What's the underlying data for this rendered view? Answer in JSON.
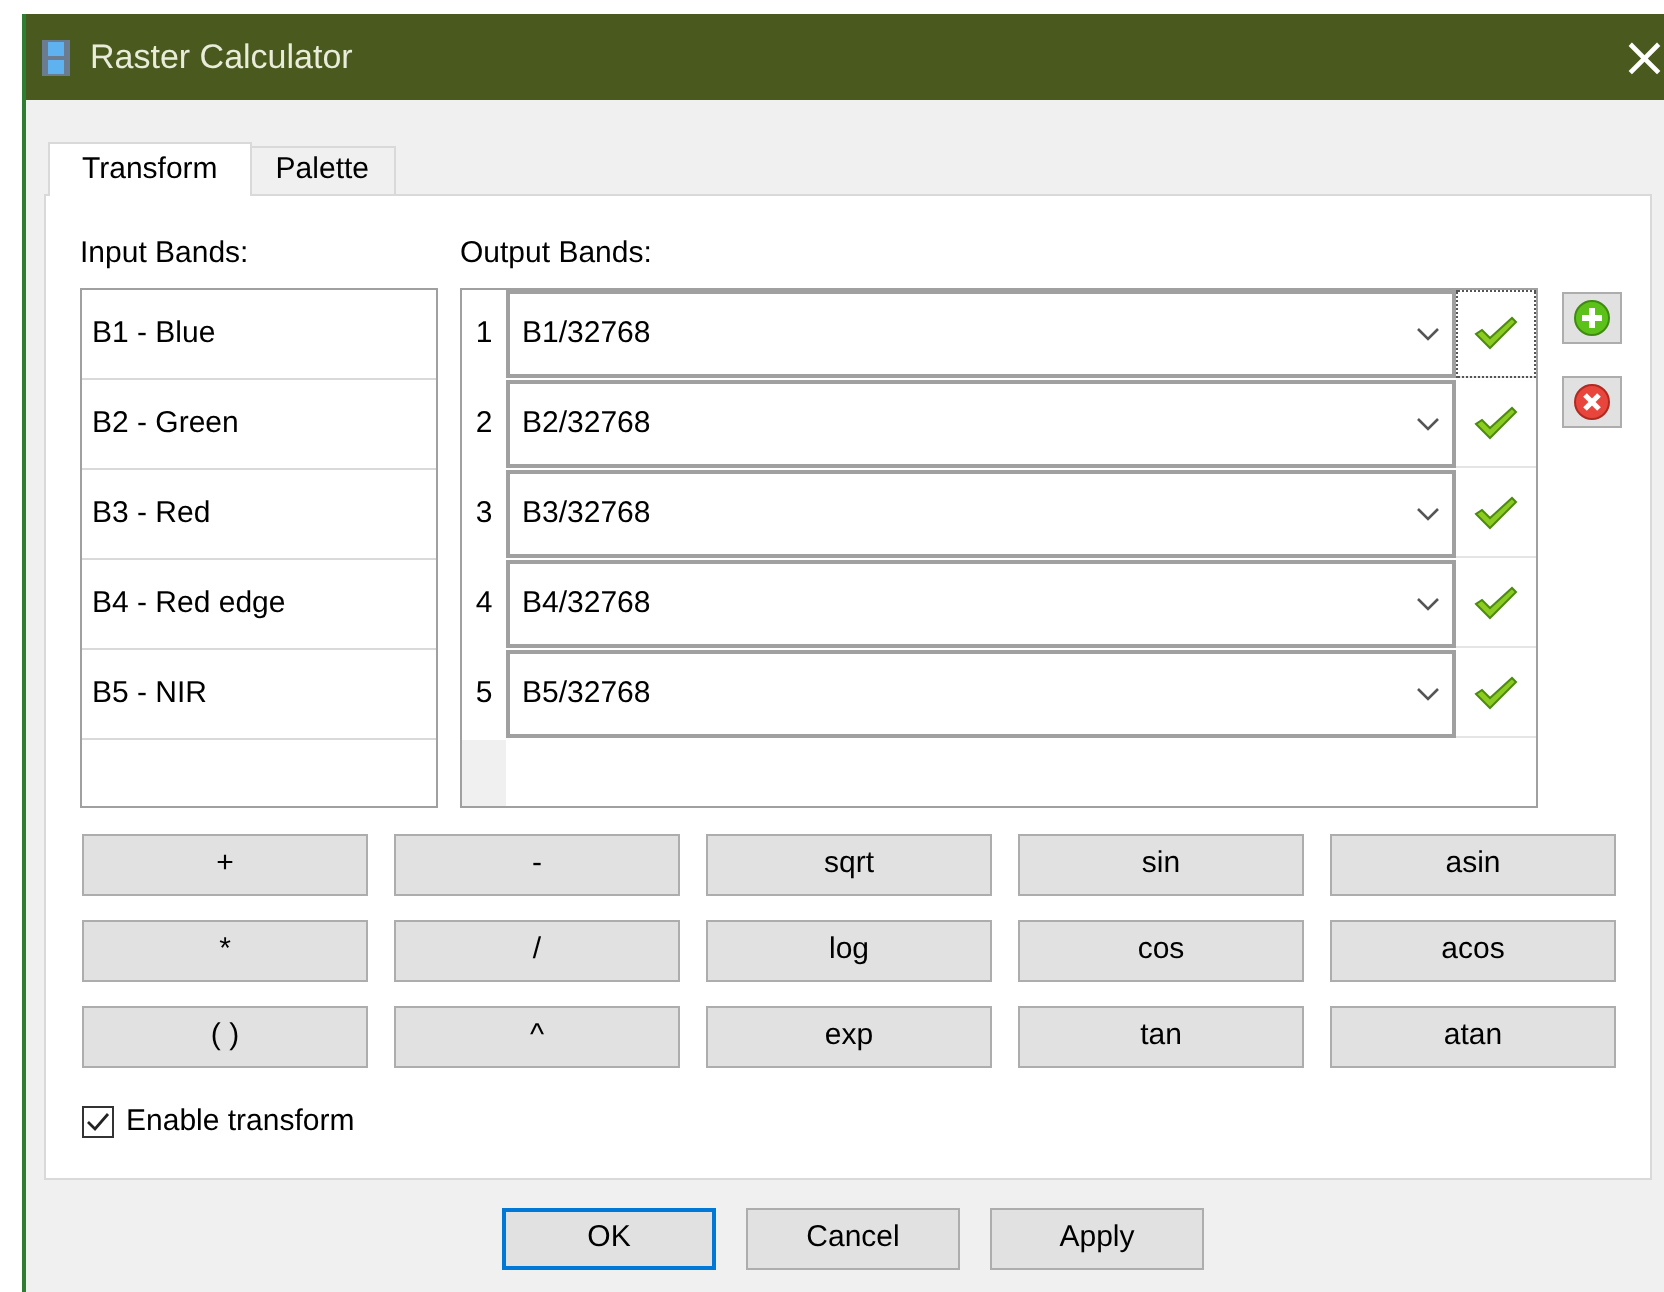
{
  "window": {
    "title": "Raster Calculator",
    "close": "×"
  },
  "tabs": [
    {
      "label": "Transform",
      "selected": true
    },
    {
      "label": "Palette",
      "selected": false
    }
  ],
  "input_bands": {
    "label": "Input Bands:",
    "items": [
      "B1 - Blue",
      "B2 - Green",
      "B3 - Red",
      "B4 - Red edge",
      "B5 - NIR"
    ]
  },
  "output_bands": {
    "label": "Output Bands:",
    "rows": [
      {
        "number": "1",
        "expression": "B1/32768",
        "valid": true
      },
      {
        "number": "2",
        "expression": "B2/32768",
        "valid": true
      },
      {
        "number": "3",
        "expression": "B3/32768",
        "valid": true
      },
      {
        "number": "4",
        "expression": "B4/32768",
        "valid": true
      },
      {
        "number": "5",
        "expression": "B5/32768",
        "valid": true
      }
    ]
  },
  "operator_buttons": [
    "+",
    "-",
    "sqrt",
    "sin",
    "asin",
    "*",
    "/",
    "log",
    "cos",
    "acos",
    "( )",
    "^",
    "exp",
    "tan",
    "atan"
  ],
  "enable_transform": {
    "label": "Enable transform",
    "checked": true
  },
  "buttons": [
    {
      "label": "OK",
      "default": true
    },
    {
      "label": "Cancel",
      "default": false
    },
    {
      "label": "Apply",
      "default": false
    }
  ]
}
